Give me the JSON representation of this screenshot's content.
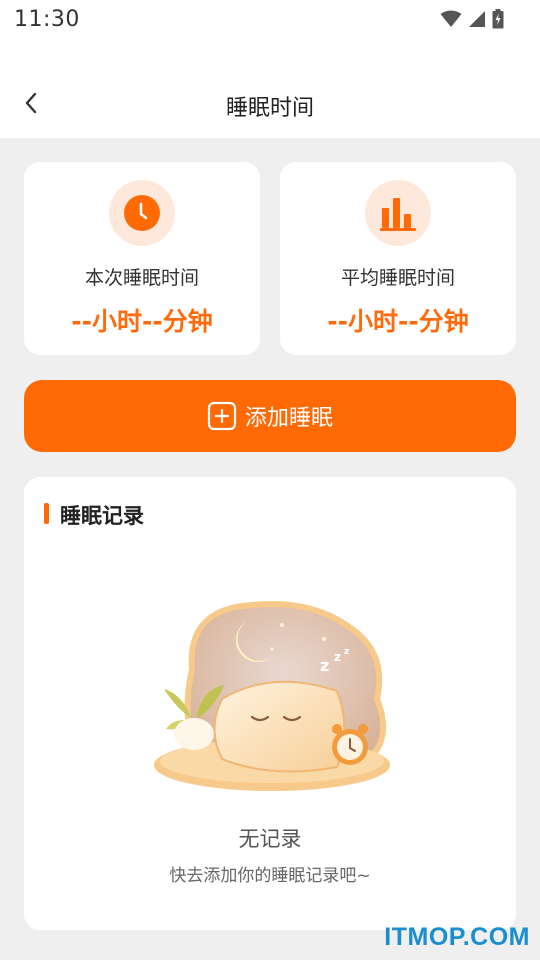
{
  "status_bar": {
    "time": "11:30"
  },
  "header": {
    "title": "睡眠时间"
  },
  "stats": [
    {
      "label": "本次睡眠时间",
      "value": "--小时--分钟",
      "icon": "clock-icon"
    },
    {
      "label": "平均睡眠时间",
      "value": "--小时--分钟",
      "icon": "bar-chart-icon"
    }
  ],
  "add_button": {
    "label": "添加睡眠",
    "icon": "plus-square-icon"
  },
  "records": {
    "title": "睡眠记录",
    "empty_title": "无记录",
    "empty_subtitle": "快去添加你的睡眠记录吧~"
  },
  "watermark": "ITMOP.COM",
  "colors": {
    "accent": "#ff6a05",
    "accent_light": "#fde8db",
    "background": "#efefef"
  }
}
